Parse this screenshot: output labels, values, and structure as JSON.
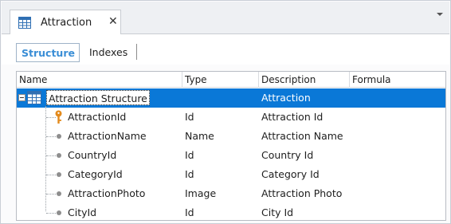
{
  "document_tab": {
    "title": "Attraction",
    "close_glyph": "✕",
    "icon": "table-grid-icon"
  },
  "subtabs": {
    "structure": "Structure",
    "indexes": "Indexes",
    "active": "Structure"
  },
  "columns": {
    "name": "Name",
    "type": "Type",
    "description": "Description",
    "formula": "Formula"
  },
  "root": {
    "name": "Attraction Structure",
    "type": "",
    "description": "Attraction",
    "formula": ""
  },
  "attributes": [
    {
      "name": "AttractionId",
      "type": "Id",
      "description": "Attraction Id",
      "formula": "",
      "icon": "key-icon"
    },
    {
      "name": "AttractionName",
      "type": "Name",
      "description": "Attraction Name",
      "formula": "",
      "icon": "bullet-icon"
    },
    {
      "name": "CountryId",
      "type": "Id",
      "description": "Country Id",
      "formula": "",
      "icon": "bullet-icon"
    },
    {
      "name": "CategoryId",
      "type": "Id",
      "description": "Category Id",
      "formula": "",
      "icon": "bullet-icon"
    },
    {
      "name": "AttractionPhoto",
      "type": "Image",
      "description": "Attraction Photo",
      "formula": "",
      "icon": "bullet-icon"
    },
    {
      "name": "CityId",
      "type": "Id",
      "description": "City Id",
      "formula": "",
      "icon": "bullet-icon"
    }
  ],
  "colors": {
    "selection": "#0a78d7",
    "active_subtab": "#3a8ed6",
    "key_icon": "#e38a1c"
  }
}
